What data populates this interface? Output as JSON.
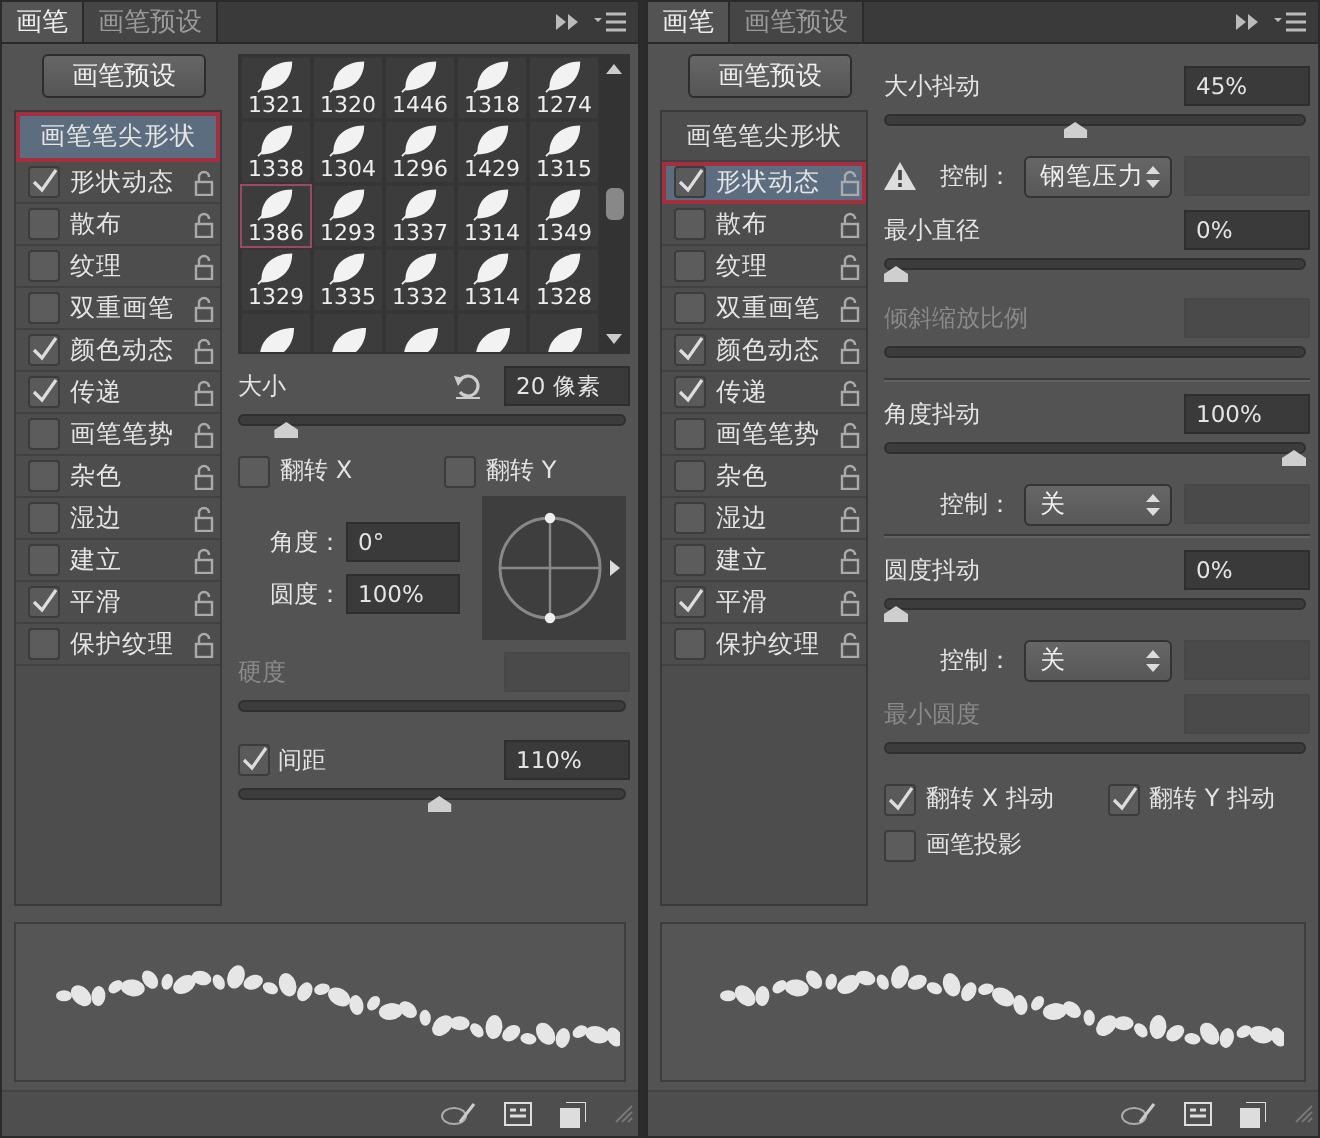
{
  "panels": [
    {
      "tabs": [
        {
          "label": "画笔",
          "selected": true
        },
        {
          "label": "画笔预设",
          "selected": false
        }
      ],
      "preset_button": "画笔预设",
      "options": [
        {
          "label": "画笔笔尖形状",
          "kind": "header",
          "selected": true
        },
        {
          "label": "形状动态",
          "kind": "option",
          "checked": true,
          "selected": false
        },
        {
          "label": "散布",
          "kind": "option",
          "checked": false,
          "selected": false
        },
        {
          "label": "纹理",
          "kind": "option",
          "checked": false,
          "selected": false
        },
        {
          "label": "双重画笔",
          "kind": "option",
          "checked": false,
          "selected": false
        },
        {
          "label": "颜色动态",
          "kind": "option",
          "checked": true,
          "selected": false
        },
        {
          "label": "传递",
          "kind": "option",
          "checked": true,
          "selected": false
        },
        {
          "label": "画笔笔势",
          "kind": "option",
          "checked": false,
          "selected": false
        },
        {
          "label": "杂色",
          "kind": "option",
          "checked": false,
          "selected": false
        },
        {
          "label": "湿边",
          "kind": "option",
          "checked": false,
          "selected": false
        },
        {
          "label": "建立",
          "kind": "option",
          "checked": false,
          "selected": false
        },
        {
          "label": "平滑",
          "kind": "option",
          "checked": true,
          "selected": false
        },
        {
          "label": "保护纹理",
          "kind": "option",
          "checked": false,
          "selected": false
        }
      ],
      "content": [
        {
          "kind": "grid",
          "tiles": [
            {
              "label": "1321",
              "selected": false
            },
            {
              "label": "1320",
              "selected": false
            },
            {
              "label": "1446",
              "selected": false
            },
            {
              "label": "1318",
              "selected": false
            },
            {
              "label": "1274",
              "selected": false
            },
            {
              "label": "1338",
              "selected": false
            },
            {
              "label": "1304",
              "selected": false
            },
            {
              "label": "1296",
              "selected": false
            },
            {
              "label": "1429",
              "selected": false
            },
            {
              "label": "1315",
              "selected": false
            },
            {
              "label": "1386",
              "selected": true
            },
            {
              "label": "1293",
              "selected": false
            },
            {
              "label": "1337",
              "selected": false
            },
            {
              "label": "1314",
              "selected": false
            },
            {
              "label": "1349",
              "selected": false
            },
            {
              "label": "1329",
              "selected": false
            },
            {
              "label": "1335",
              "selected": false
            },
            {
              "label": "1332",
              "selected": false
            },
            {
              "label": "1314",
              "selected": false
            },
            {
              "label": "1328",
              "selected": false
            },
            {
              "selected": false
            },
            {
              "selected": false
            },
            {
              "selected": false
            },
            {
              "selected": false
            },
            {
              "selected": false
            }
          ]
        },
        {
          "kind": "slider",
          "label": "大小",
          "value": "20 像素",
          "reset": true,
          "level": 0.1
        },
        {
          "kind": "checks",
          "checks": [
            {
              "label": "翻转 X",
              "checked": false
            },
            {
              "label": "翻转 Y",
              "checked": false
            }
          ]
        },
        {
          "kind": "angle",
          "fields": [
            {
              "label": "角度：",
              "value": "0°"
            },
            {
              "label": "圆度：",
              "value": "100%"
            }
          ]
        },
        {
          "kind": "slider",
          "label": "硬度",
          "disabled": true
        },
        {
          "kind": "slider",
          "label": "间距",
          "checked": true,
          "value": "110%",
          "level": 0.52
        }
      ]
    },
    {
      "tabs": [
        {
          "label": "画笔",
          "selected": true
        },
        {
          "label": "画笔预设",
          "selected": false
        }
      ],
      "preset_button": "画笔预设",
      "options": [
        {
          "label": "画笔笔尖形状",
          "kind": "header",
          "selected": false
        },
        {
          "label": "形状动态",
          "kind": "option",
          "checked": true,
          "selected": true
        },
        {
          "label": "散布",
          "kind": "option",
          "checked": false,
          "selected": false
        },
        {
          "label": "纹理",
          "kind": "option",
          "checked": false,
          "selected": false
        },
        {
          "label": "双重画笔",
          "kind": "option",
          "checked": false,
          "selected": false
        },
        {
          "label": "颜色动态",
          "kind": "option",
          "checked": true,
          "selected": false
        },
        {
          "label": "传递",
          "kind": "option",
          "checked": true,
          "selected": false
        },
        {
          "label": "画笔笔势",
          "kind": "option",
          "checked": false,
          "selected": false
        },
        {
          "label": "杂色",
          "kind": "option",
          "checked": false,
          "selected": false
        },
        {
          "label": "湿边",
          "kind": "option",
          "checked": false,
          "selected": false
        },
        {
          "label": "建立",
          "kind": "option",
          "checked": false,
          "selected": false
        },
        {
          "label": "平滑",
          "kind": "option",
          "checked": true,
          "selected": false
        },
        {
          "label": "保护纹理",
          "kind": "option",
          "checked": false,
          "selected": false
        }
      ],
      "content": [
        {
          "kind": "slider",
          "label": "大小抖动",
          "value": "45%",
          "level": 0.45
        },
        {
          "kind": "control",
          "warning": true,
          "label": "控制：",
          "value": "钢笔压力"
        },
        {
          "kind": "slider",
          "label": "最小直径",
          "value": "0%",
          "level": 0
        },
        {
          "kind": "slider",
          "label": "倾斜缩放比例",
          "disabled": true,
          "divider": true
        },
        {
          "kind": "slider",
          "label": "角度抖动",
          "value": "100%",
          "level": 1
        },
        {
          "kind": "control",
          "label": "控制：",
          "value": "关",
          "divider": true
        },
        {
          "kind": "slider",
          "label": "圆度抖动",
          "value": "0%",
          "level": 0
        },
        {
          "kind": "control",
          "label": "控制：",
          "value": "关"
        },
        {
          "kind": "slider",
          "label": "最小圆度",
          "disabled": true
        },
        {
          "kind": "checks",
          "checks": [
            {
              "label": "翻转 X 抖动",
              "checked": true
            },
            {
              "label": "翻转 Y 抖动",
              "checked": true
            }
          ]
        },
        {
          "kind": "checks",
          "checks": [
            {
              "label": "画笔投影",
              "checked": false
            }
          ]
        }
      ]
    }
  ]
}
